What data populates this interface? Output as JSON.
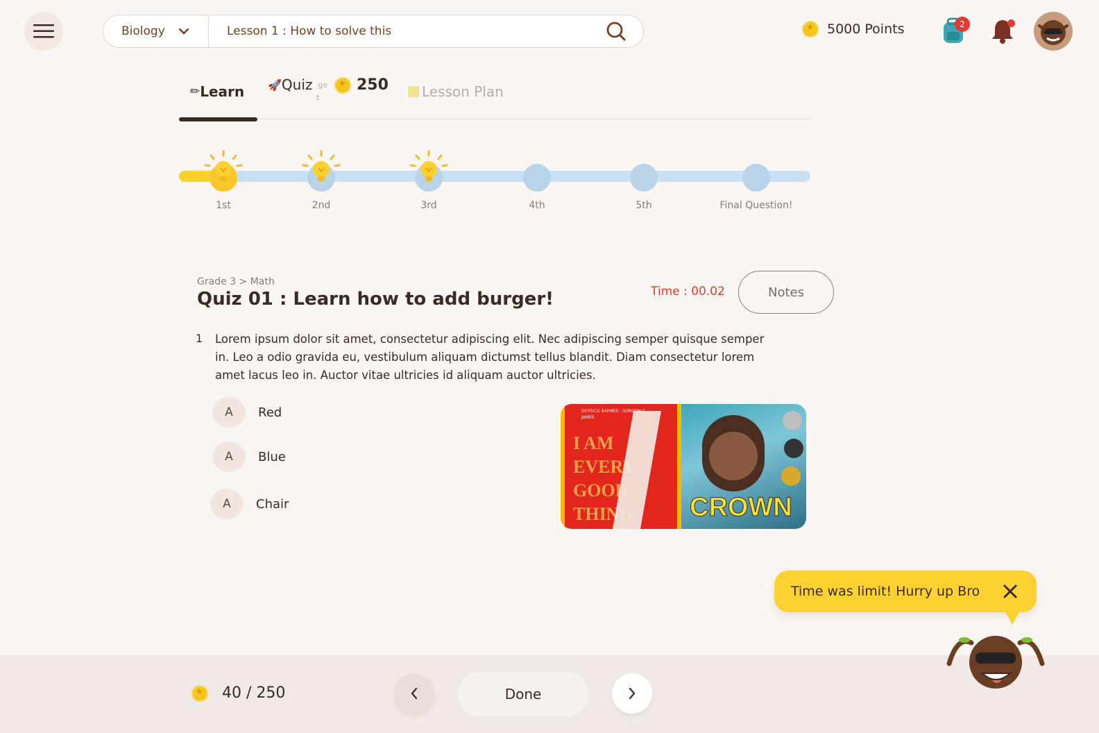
{
  "header": {
    "subject": "Biology",
    "search_value": "Lesson 1 : How to solve this",
    "points_label": "5000 Points",
    "backpack_badge": "2"
  },
  "tabs": {
    "learn": "Learn",
    "quiz": "Quiz",
    "quiz_small_1": "ge",
    "quiz_small_2": "t",
    "quiz_points": "250",
    "lesson_plan": "Lesson Plan"
  },
  "progress": {
    "completed_steps": 3,
    "fill_fraction": 0.08,
    "steps": [
      "1st",
      "2nd",
      "3rd",
      "4th",
      "5th",
      "Final Question!"
    ]
  },
  "quiz": {
    "breadcrumb": "Grade 3 > Math",
    "title": "Quiz 01 : Learn how to add burger!",
    "timer": "Time : 00.02",
    "notes_label": "Notes",
    "question_number": "1",
    "question_text": "Lorem ipsum dolor sit amet, consectetur adipiscing elit. Nec adipiscing semper quisque semper in. Leo a odio gravida eu, vestibulum aliquam dictumst tellus blandit. Diam consectetur lorem amet lacus leo in. Auctor vitae ultricies id aliquam auctor ultricies.",
    "options": [
      {
        "letter": "A",
        "label": "Red"
      },
      {
        "letter": "A",
        "label": "Blue"
      },
      {
        "letter": "A",
        "label": "Chair"
      }
    ],
    "book_covers": {
      "left_authors": "DERRICK BARNES · GORDON C. JAMES",
      "left_title": "I AM EVERY GOOD THING",
      "right_title": "CROWN"
    }
  },
  "toast": {
    "message": "Time was limit! Hurry up Bro"
  },
  "footer": {
    "score": "40 / 250",
    "done_label": "Done"
  },
  "colors": {
    "accent_yellow": "#fbd232",
    "brand_brown": "#3b2a23",
    "timer_red": "#e53a2f",
    "track_blue": "#c9e1f3"
  }
}
